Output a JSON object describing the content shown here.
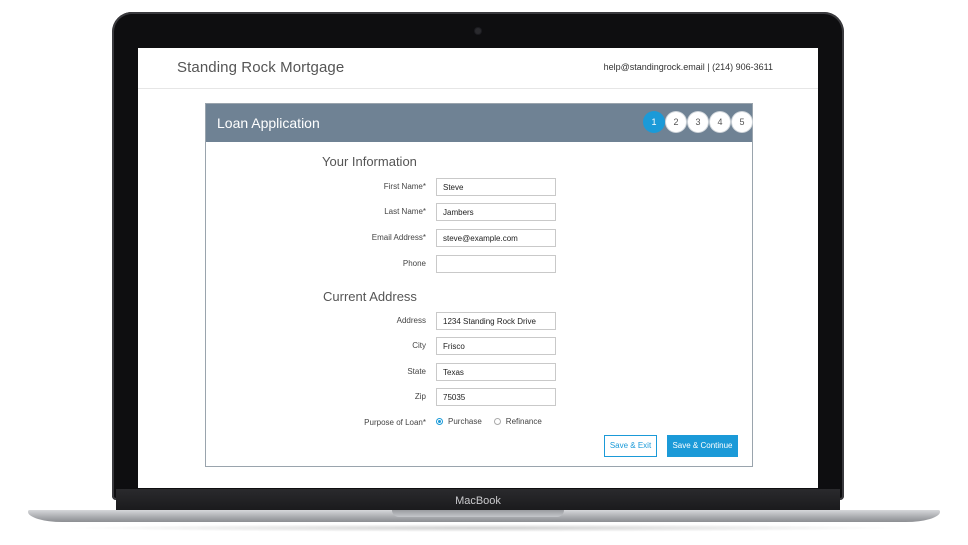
{
  "device": {
    "label": "MacBook"
  },
  "site": {
    "brand": "Standing Rock Mortgage",
    "contact": "help@standingrock.email | (214) 906-3611"
  },
  "form": {
    "title": "Loan Application",
    "steps": [
      "1",
      "2",
      "3",
      "4",
      "5"
    ],
    "active_step": 1,
    "sections": {
      "info_title": "Your Information",
      "address_title": "Current Address"
    },
    "fields": {
      "first_name": {
        "label": "First Name*",
        "value": "Steve"
      },
      "last_name": {
        "label": "Last Name*",
        "value": "Jambers"
      },
      "email": {
        "label": "Email Address*",
        "value": "steve@example.com"
      },
      "phone": {
        "label": "Phone",
        "value": ""
      },
      "address": {
        "label": "Address",
        "value": "1234 Standing Rock Drive"
      },
      "city": {
        "label": "City",
        "value": "Frisco"
      },
      "state": {
        "label": "State",
        "value": "Texas"
      },
      "zip": {
        "label": "Zip",
        "value": "75035"
      }
    },
    "purpose": {
      "label": "Purpose of Loan*",
      "options": [
        "Purchase",
        "Refinance"
      ],
      "selected": "Purchase"
    },
    "buttons": {
      "save_exit": "Save & Exit",
      "save_continue": "Save & Continue"
    }
  },
  "colors": {
    "accent": "#1b9ad8",
    "header_bg": "#6f8294"
  }
}
